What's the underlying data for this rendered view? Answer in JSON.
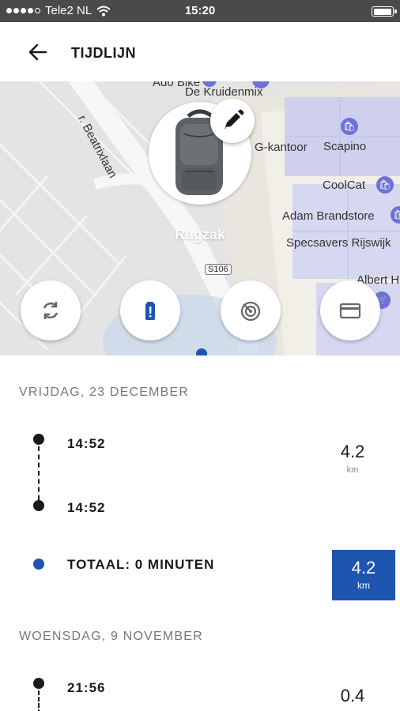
{
  "status_bar": {
    "carrier": "Tele2 NL",
    "time": "15:20"
  },
  "header": {
    "title": "TIJDLIJN"
  },
  "map": {
    "labels": [
      "Ado Bike",
      "De Kruidenmix",
      "r. Beatrixlaan",
      "G-kantoor",
      "Scapino",
      "CoolCat",
      "Adam Brandstore",
      "Specsavers Rijswijk",
      "Albert H",
      "S106"
    ]
  },
  "item": {
    "name": "Rugzak"
  },
  "timeline": {
    "days": [
      {
        "date": "VRIJDAG, 23 DECEMBER",
        "start_time": "14:52",
        "end_time": "14:52",
        "distance": "4.2",
        "unit": "km",
        "total_label": "TOTAAL: 0 MINUTEN",
        "total_distance": "4.2",
        "total_unit": "km"
      },
      {
        "date": "WOENSDAG, 9 NOVEMBER",
        "start_time": "21:56",
        "distance": "0.4"
      }
    ]
  },
  "colors": {
    "accent": "#1d55b0",
    "map_bg": "#e4e4e4",
    "building": "#cfd0ee"
  }
}
